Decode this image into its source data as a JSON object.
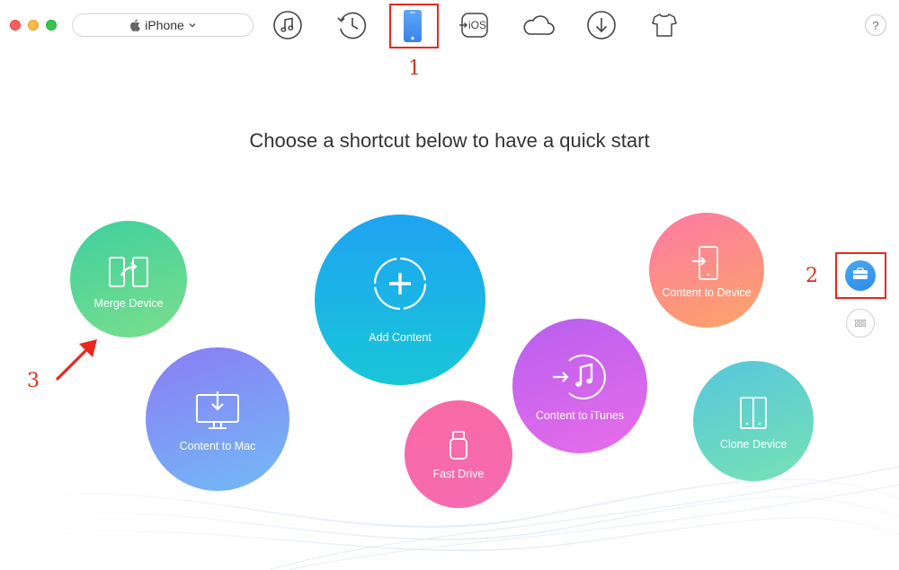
{
  "toolbar": {
    "device_name": "iPhone",
    "icons": [
      "music-icon",
      "history-icon",
      "device-icon",
      "to-ios-icon",
      "icloud-icon",
      "download-icon",
      "tshirt-icon"
    ],
    "to_ios_label": "iOS",
    "help_label": "?"
  },
  "annotations": {
    "one": "1",
    "two": "2",
    "three": "3",
    "color": "#e8281c"
  },
  "main": {
    "title": "Choose a shortcut below to have a quick start"
  },
  "shortcuts": {
    "merge_device": "Merge Device",
    "content_to_mac": "Content to Mac",
    "add_content": "Add Content",
    "fast_drive": "Fast Drive",
    "content_to_itunes": "Content to iTunes",
    "content_to_device": "Content to Device",
    "clone_device": "Clone Device"
  },
  "colors": {
    "active_icon": "#4a90f2",
    "toolbar_icon": "#444444"
  }
}
